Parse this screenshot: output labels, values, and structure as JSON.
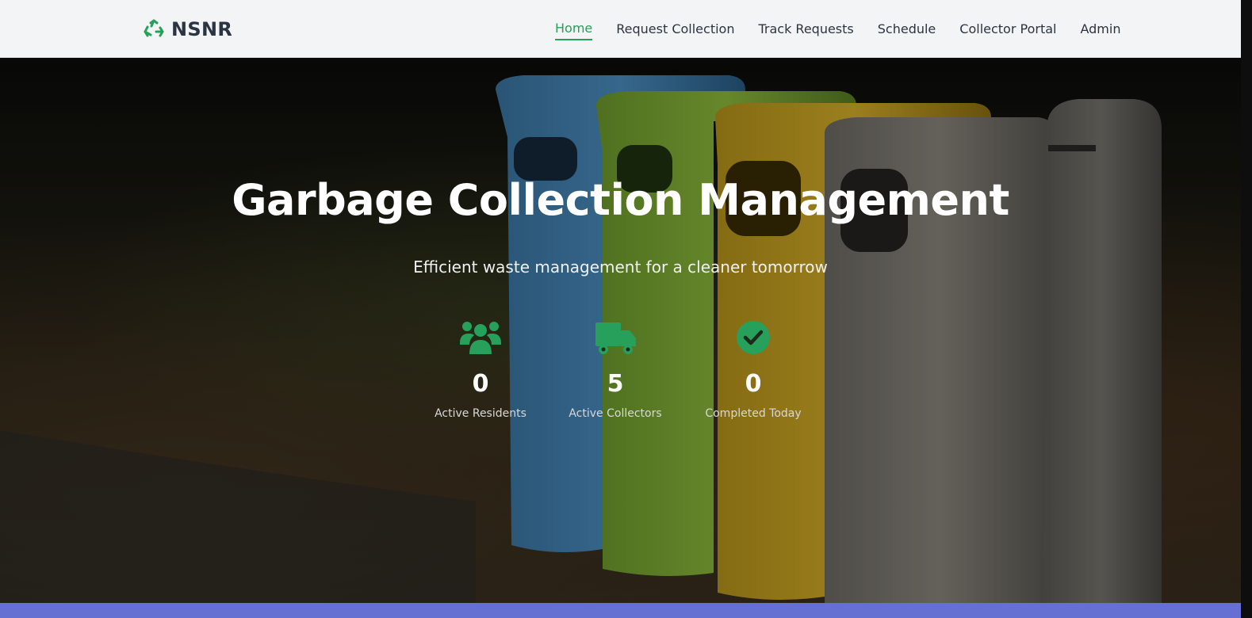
{
  "brand": {
    "name": "NSNR",
    "icon": "recycle-icon",
    "color": "#26a05a"
  },
  "nav": {
    "items": [
      {
        "label": "Home",
        "active": true
      },
      {
        "label": "Request Collection",
        "active": false
      },
      {
        "label": "Track Requests",
        "active": false
      },
      {
        "label": "Schedule",
        "active": false
      },
      {
        "label": "Collector Portal",
        "active": false
      },
      {
        "label": "Admin",
        "active": false
      }
    ]
  },
  "hero": {
    "title": "Garbage Collection Management",
    "subtitle": "Efficient waste management for a cleaner tomorrow",
    "stats": [
      {
        "icon": "users-icon",
        "value": "0",
        "label": "Active Residents"
      },
      {
        "icon": "truck-icon",
        "value": "5",
        "label": "Active Collectors"
      },
      {
        "icon": "check-circle-icon",
        "value": "0",
        "label": "Completed Today"
      }
    ]
  },
  "colors": {
    "accent": "#26a05a",
    "nav_bg": "#f3f4f5",
    "footer_bar": "#6670d3"
  }
}
